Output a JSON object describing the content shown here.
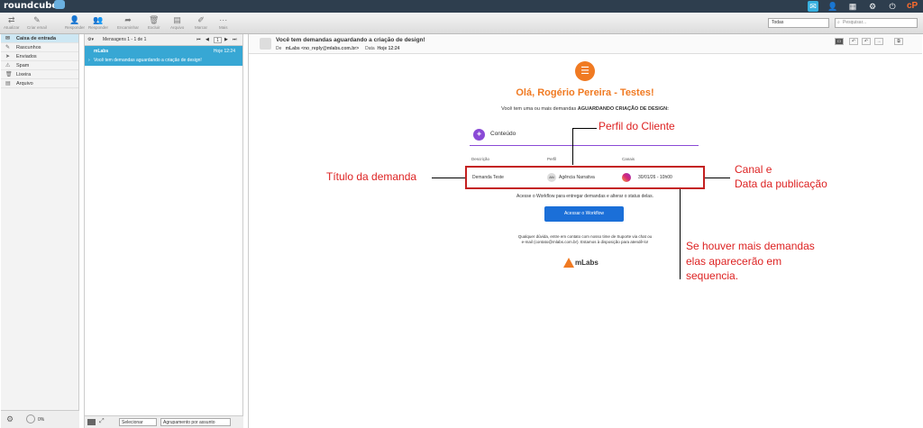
{
  "app": {
    "name": "roundcube"
  },
  "toolbar": {
    "buttons": [
      {
        "label": "Atualizar",
        "icon": "refresh-icon"
      },
      {
        "label": "Criar email",
        "icon": "compose-icon"
      },
      {
        "label": "Responder",
        "icon": "reply-icon"
      },
      {
        "label": "Responder",
        "icon": "reply-all-icon"
      },
      {
        "label": "Encaminhar",
        "icon": "forward-icon"
      },
      {
        "label": "Excluir",
        "icon": "trash-icon"
      },
      {
        "label": "Arquivo",
        "icon": "archive-icon"
      },
      {
        "label": "Marcar",
        "icon": "mark-icon"
      },
      {
        "label": "Mais",
        "icon": "more-icon"
      }
    ],
    "filter": "Todas",
    "search_placeholder": "Pesquisar..."
  },
  "folders": [
    {
      "label": "Caixa de entrada",
      "icon": "inbox-icon",
      "selected": true
    },
    {
      "label": "Rascunhos",
      "icon": "drafts-icon"
    },
    {
      "label": "Enviados",
      "icon": "sent-icon"
    },
    {
      "label": "Spam",
      "icon": "spam-icon"
    },
    {
      "label": "Lixeira",
      "icon": "trash-icon"
    },
    {
      "label": "Arquivo",
      "icon": "archive-icon"
    }
  ],
  "quota": "0%",
  "msglist": {
    "header": "Mensagens 1 - 1 de 1",
    "page": "1",
    "rows": [
      {
        "from": "mLabs",
        "date": "Hoje 12:24",
        "subject": "Você tem demandas aguardando a criação de design!"
      }
    ],
    "select_label": "Selecionar",
    "thread_label": "Agrupamento por assunto"
  },
  "message": {
    "subject": "Você tem demandas aguardando a criação de design!",
    "from_label": "De",
    "from": "mLabs <no_reply@mlabs.com.br>",
    "date_label": "Data",
    "date": "Hoje 12:24"
  },
  "email": {
    "greeting": "Olá, Rogério Pereira - Testes!",
    "intro_prefix": "Você tem uma ou mais demandas ",
    "intro_bold": "AGUARDANDO CRIAÇÃO DE DESIGN:",
    "section": "Conteúdo",
    "col_desc": "Descrição",
    "col_profile": "Perfil",
    "col_channels": "Canais",
    "row": {
      "title": "Demanda Teste",
      "avatar": "AN",
      "profile": "Agência Narrativa",
      "date": "30/01/26 - 10h00"
    },
    "access_text": "Acesse o Workflow para entregar demandas e alterar o status delas.",
    "button": "Acessar o Workflow",
    "help1": "Qualquer dúvida, entre em contato com nosso time de Suporte via chat ou",
    "help2": "e-mail (contato@mlabs.com.br). Estamos à disposição para atendê-lo!",
    "brand": "mLabs"
  },
  "annotations": {
    "profile": "Perfil do Cliente",
    "title": "Título da demanda",
    "channel1": "Canal e",
    "channel2": "Data da publicação",
    "more1": "Se houver mais demandas",
    "more2": "elas aparecerão em",
    "more3": "sequencia."
  },
  "colors": {
    "accent": "#f07a22",
    "highlight": "#d22b2b",
    "selection": "#37a7d4",
    "button": "#1b6fd8",
    "topbar": "#2e3e4e"
  }
}
